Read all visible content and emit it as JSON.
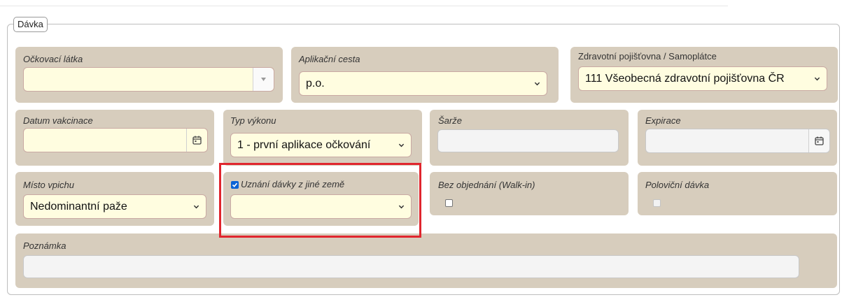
{
  "fieldset": {
    "legend": "Dávka"
  },
  "fields": {
    "vaccine": {
      "label": "Očkovací látka",
      "value": ""
    },
    "route": {
      "label": "Aplikační cesta",
      "value": "p.o."
    },
    "insurer": {
      "label": "Zdravotní pojišťovna / Samoplátce",
      "value": "111 Všeobecná zdravotní pojišťovna ČR"
    },
    "vaccination_date": {
      "label": "Datum vakcinace",
      "value": ""
    },
    "procedure_type": {
      "label": "Typ výkonu",
      "value": "1 - první aplikace očkování"
    },
    "batch": {
      "label": "Šarže",
      "value": ""
    },
    "expiration": {
      "label": "Expirace",
      "value": ""
    },
    "injection_site": {
      "label": "Místo vpichu",
      "value": "Nedominantní paže"
    },
    "foreign_dose": {
      "label": "Uznání dávky z jiné země",
      "checked": true,
      "value": ""
    },
    "walk_in": {
      "label": "Bez objednání (Walk-in)",
      "checked": false
    },
    "half_dose": {
      "label": "Poloviční dávka",
      "checked": false,
      "disabled": true
    },
    "note": {
      "label": "Poznámka",
      "value": ""
    }
  },
  "icons": {
    "calendar": "calendar-icon",
    "dropdown": "chevron-down-icon",
    "combo": "triangle-down-icon"
  },
  "colors": {
    "panel": "#d7cdbd",
    "input_required": "#fffde0",
    "input_border_required": "#c9a9a3",
    "highlight": "#e0262e",
    "checkbox_checked": "#0b63d6"
  }
}
